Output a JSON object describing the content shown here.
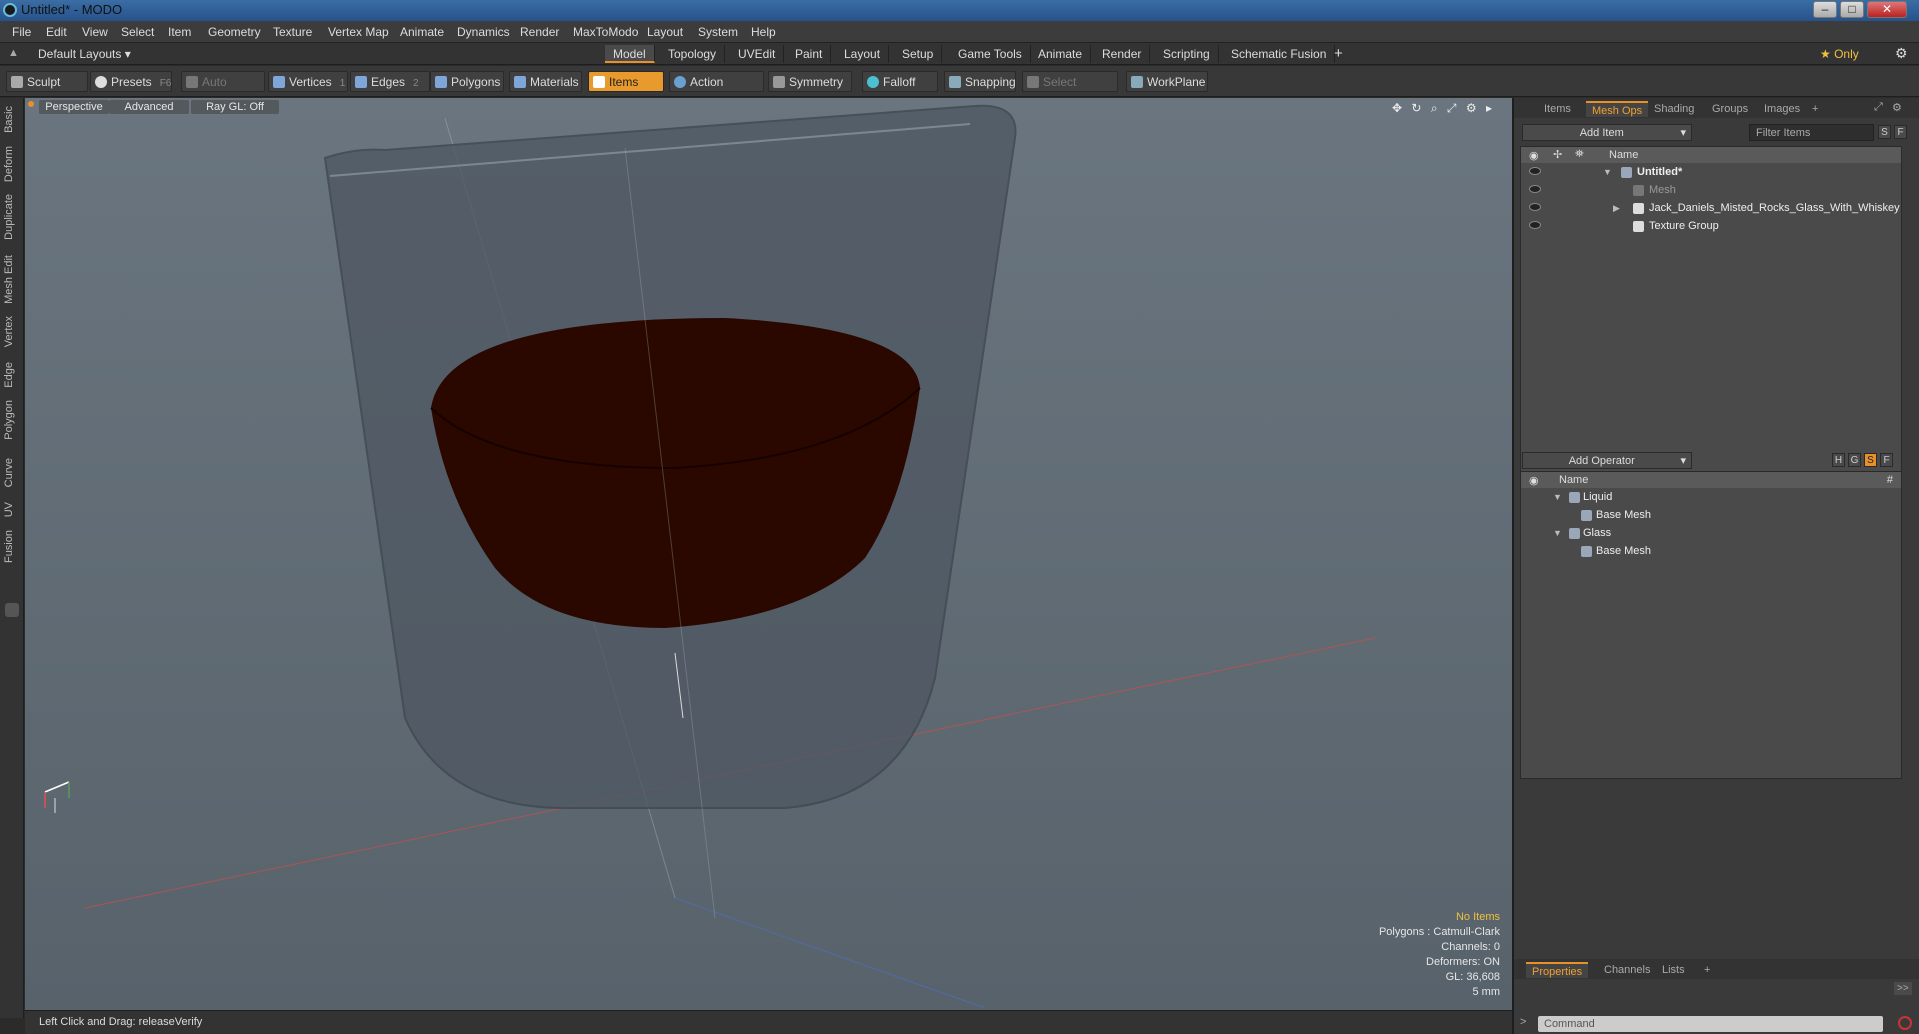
{
  "window": {
    "title": "Untitled* - MODO"
  },
  "menu": [
    "File",
    "Edit",
    "View",
    "Select",
    "Item",
    "Geometry",
    "Texture",
    "Vertex Map",
    "Animate",
    "Dynamics",
    "Render",
    "MaxToModo",
    "Layout",
    "System",
    "Help"
  ],
  "layout": {
    "default_layouts": "Default Layouts ▾",
    "tabs": [
      "Model",
      "Topology",
      "UVEdit",
      "Paint",
      "Layout",
      "Setup",
      "Game Tools",
      "Animate",
      "Render",
      "Scripting",
      "Schematic Fusion"
    ],
    "active_tab": "Model",
    "add": "+",
    "only": "★ Only"
  },
  "toolbar": {
    "sculpt": "Sculpt",
    "presets": "Presets",
    "presets_key": "F6",
    "auto_select": "Auto Select",
    "vertices": "Vertices",
    "vertices_key": "1",
    "edges": "Edges",
    "edges_key": "2",
    "polygons": "Polygons",
    "materials": "Materials",
    "items": "Items",
    "action_center": "Action Center",
    "symmetry": "Symmetry",
    "falloff": "Falloff",
    "snapping": "Snapping",
    "select_through": "Select Through",
    "workplane": "WorkPlane"
  },
  "left_tabs": [
    "Basic",
    "Deform",
    "Duplicate",
    "Mesh Edit",
    "Vertex",
    "Edge",
    "Polygon",
    "Curve",
    "UV",
    "Fusion"
  ],
  "viewport": {
    "view": "Perspective",
    "mode": "Advanced",
    "raygl": "Ray GL: Off",
    "info": {
      "items": "No Items",
      "polygons": "Polygons : Catmull-Clark",
      "channels": "Channels: 0",
      "deformers": "Deformers: ON",
      "gl": "GL: 36,608",
      "scale": "5 mm"
    }
  },
  "status": "Left Click and Drag:   releaseVerify",
  "items_panel": {
    "tabs": [
      "Items",
      "Mesh Ops",
      "Shading",
      "Groups",
      "Images",
      "+"
    ],
    "active_tab": "Mesh Ops",
    "add_item": "Add Item",
    "filter": "Filter Items",
    "col_name": "Name",
    "rows": [
      {
        "label": "Untitled*"
      },
      {
        "label": "Mesh"
      },
      {
        "label": "Jack_Daniels_Misted_Rocks_Glass_With_Whiskey…"
      },
      {
        "label": "Texture Group"
      }
    ]
  },
  "operator_panel": {
    "add_operator": "Add Operator",
    "col_name": "Name",
    "col_hash": "#",
    "rows": [
      {
        "label": "Liquid"
      },
      {
        "label": "Base Mesh"
      },
      {
        "label": "Glass"
      },
      {
        "label": "Base Mesh"
      }
    ]
  },
  "bottom_panel": {
    "tabs": [
      "Properties",
      "Channels",
      "Lists",
      "+"
    ],
    "active_tab": "Properties",
    "command_placeholder": "Command",
    "more": ">>"
  },
  "colors": {
    "accent": "#e8902a",
    "liquid": "#2a0800",
    "glass": "#4f5862"
  }
}
